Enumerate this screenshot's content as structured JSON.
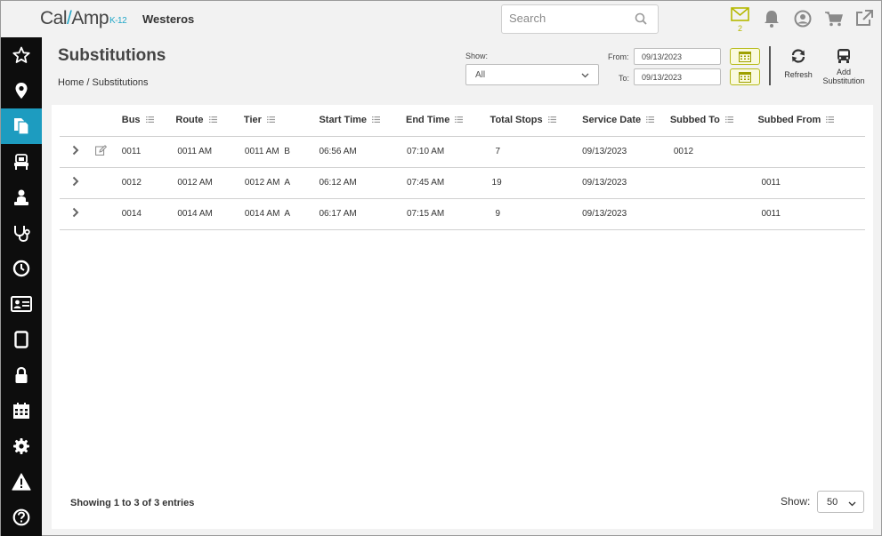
{
  "app": {
    "logo_main": "Cal",
    "logo_slash": "/",
    "logo_amp": "Amp",
    "logo_k12": "K-12",
    "district": "Westeros"
  },
  "search": {
    "placeholder": "Search"
  },
  "topbar": {
    "mail_count": "2",
    "accent": "#b5b800"
  },
  "sidebar": {
    "items": [
      {
        "icon": "star-icon"
      },
      {
        "icon": "map-pin-icon"
      },
      {
        "icon": "copy-documents-icon",
        "active": true
      },
      {
        "icon": "school-bus-seat-icon"
      },
      {
        "icon": "student-icon"
      },
      {
        "icon": "stethoscope-icon"
      },
      {
        "icon": "clock-icon"
      },
      {
        "icon": "id-card-icon"
      },
      {
        "icon": "tablet-icon"
      },
      {
        "icon": "lock-icon"
      },
      {
        "icon": "calendar-icon"
      },
      {
        "icon": "gear-icon"
      },
      {
        "icon": "warning-icon"
      },
      {
        "icon": "help-icon"
      }
    ],
    "active_color": "#1d9cc0"
  },
  "page": {
    "title": "Substitutions",
    "breadcrumb_home": "Home",
    "breadcrumb_sep": "/",
    "breadcrumb_current": "Substitutions"
  },
  "filters": {
    "show_label": "Show:",
    "show_value": "All",
    "from_label": "From:",
    "from_value": "09/13/2023",
    "to_label": "To:",
    "to_value": "09/13/2023"
  },
  "toolbar": {
    "refresh_label": "Refresh",
    "add_label_1": "Add",
    "add_label_2": "Substitution"
  },
  "table": {
    "columns": [
      "Bus",
      "Route",
      "Tier",
      "Start Time",
      "End Time",
      "Total Stops",
      "Service Date",
      "Subbed To",
      "Subbed From"
    ],
    "rows": [
      [
        "0011",
        "0011 AM",
        "0011 AM  B",
        "06:56 AM",
        "07:10 AM",
        "7",
        "09/13/2023",
        "0012",
        ""
      ],
      [
        "0012",
        "0012 AM",
        "0012 AM  A",
        "06:12 AM",
        "07:45 AM",
        "19",
        "09/13/2023",
        "",
        "0011"
      ],
      [
        "0014",
        "0014 AM",
        "0014 AM  A",
        "06:17 AM",
        "07:15 AM",
        "9",
        "09/13/2023",
        "",
        "0011"
      ]
    ]
  },
  "footer": {
    "info": "Showing 1 to 3 of 3 entries",
    "show_label": "Show:",
    "page_size": "50"
  }
}
